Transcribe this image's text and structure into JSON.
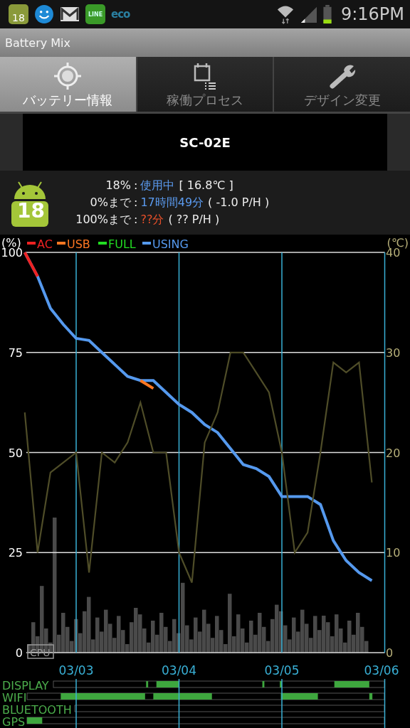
{
  "status_bar": {
    "notifications": [
      {
        "kind": "calendar",
        "text": "18"
      },
      {
        "kind": "face"
      },
      {
        "kind": "mail"
      },
      {
        "kind": "chat",
        "text": "LINE"
      },
      {
        "kind": "eco",
        "text": "eco"
      }
    ],
    "time": "9:16PM"
  },
  "window": {
    "title": "Battery Mix"
  },
  "tabs": [
    {
      "label": "バッテリー情報",
      "selected": true
    },
    {
      "label": "稼働プロセス",
      "selected": false
    },
    {
      "label": "デザイン変更",
      "selected": false
    }
  ],
  "device": {
    "name": "SC-02E"
  },
  "battery": {
    "badge": "18",
    "rows": [
      {
        "label": "18%",
        "separator": ":",
        "value": "使用中",
        "color": "#5b9bf0",
        "detail": "[ 16.8℃ ]"
      },
      {
        "label": "0%まで",
        "separator": ":",
        "value": "17時間49分",
        "color": "#5b9bf0",
        "detail": "( -1.0 P/H )"
      },
      {
        "label": "100%まで",
        "separator": ":",
        "value": "??分",
        "color": "#e8502a",
        "detail": "( ?? P/H )"
      }
    ]
  },
  "chart": {
    "cpu_label": "CPU",
    "chart_data": {
      "type": "line",
      "ylabel": "(%)",
      "categories": [
        null,
        null,
        null,
        null,
        "03/03",
        null,
        null,
        null,
        null,
        null,
        null,
        null,
        "03/04",
        null,
        null,
        null,
        null,
        null,
        null,
        null,
        "03/05",
        null,
        null,
        null,
        null,
        null,
        null,
        null,
        "03/06"
      ],
      "series": [
        {
          "name": "AC",
          "color": "#ee2222",
          "values": [
            100,
            94,
            null,
            null,
            null,
            null,
            null,
            null,
            null,
            null,
            null,
            null,
            null,
            null,
            null,
            null,
            null,
            null,
            null,
            null,
            null,
            null,
            null,
            null,
            null,
            null,
            null,
            null,
            null
          ]
        },
        {
          "name": "USB",
          "color": "#ff7722",
          "values": [
            null,
            null,
            null,
            null,
            null,
            null,
            null,
            null,
            null,
            68,
            66,
            null,
            null,
            null,
            null,
            null,
            null,
            null,
            null,
            null,
            null,
            null,
            null,
            null,
            null,
            null,
            null,
            null,
            null
          ]
        },
        {
          "name": "FULL",
          "color": "#22dd22",
          "values": [
            null,
            null,
            null,
            null,
            null,
            null,
            null,
            null,
            null,
            null,
            null,
            null,
            null,
            null,
            null,
            null,
            null,
            null,
            null,
            null,
            null,
            null,
            null,
            null,
            null,
            null,
            null,
            null,
            null
          ]
        },
        {
          "name": "USING",
          "color": "#5599ee",
          "values": [
            100,
            94,
            86,
            82,
            78.5,
            78,
            75,
            72,
            69,
            68,
            68,
            65,
            62,
            60,
            57,
            55,
            51,
            47,
            46,
            44,
            39,
            39,
            39,
            37,
            28,
            23,
            20,
            18,
            null
          ]
        }
      ],
      "ylim": [
        0,
        100
      ],
      "yticks": [
        0,
        25,
        50,
        75,
        100
      ],
      "grid": true,
      "legend": "top"
    }
  },
  "temperature": {
    "chart_data": {
      "type": "line",
      "ylabel": "(℃)",
      "categories": [
        null,
        null,
        null,
        null,
        null,
        null,
        null,
        null,
        null,
        null,
        null,
        null,
        null,
        null,
        null,
        null,
        null,
        null,
        null,
        null,
        null,
        null,
        null,
        null,
        null,
        null,
        null,
        null,
        null
      ],
      "series": [
        {
          "color": "#4f4d28",
          "values": [
            24,
            10,
            18,
            19,
            20,
            8,
            20,
            19,
            21,
            25,
            20,
            20,
            10,
            7,
            21,
            24,
            30,
            30,
            28,
            26,
            20,
            10,
            12,
            20,
            29,
            28,
            29,
            17,
            null
          ]
        }
      ],
      "ylim": [
        0,
        40
      ],
      "yticks": [
        0,
        10,
        20,
        30,
        40
      ]
    }
  },
  "activity": [
    {
      "label": "DISPLAY"
    },
    {
      "label": "WIFI"
    },
    {
      "label": "BLUETOOTH"
    },
    {
      "label": "GPS"
    }
  ]
}
